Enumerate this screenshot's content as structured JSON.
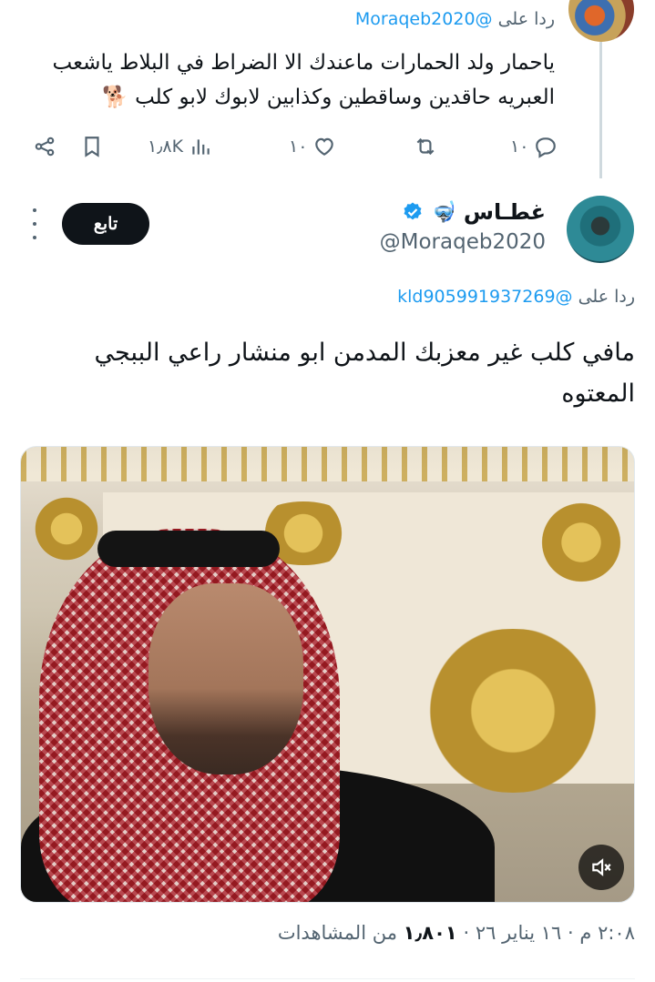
{
  "previous_tweet": {
    "reply_prefix": "ردا على",
    "reply_handle": "@Moraqeb2020",
    "text_line1": "ياحمار ولد الحمارات ماعندك الا الضراط في البلاط ياشعب",
    "text_line2": "العبريه حاقدين وساقطين وكذابين لابوك لابو كلب 🐕",
    "actions": {
      "replies": "١٠",
      "reposts": "",
      "likes": "١٠",
      "views": "١٫٨K"
    }
  },
  "main_tweet": {
    "display_name": "غطـاس",
    "name_emoji": "🤿",
    "handle": "@Moraqeb2020",
    "follow_label": "تابع",
    "reply_prefix": "ردا على",
    "reply_handle": "@kld905991937269",
    "text_line1": "مافي كلب غير معزبك المدمن ابو منشار راعي الببجي",
    "text_line2": "المعتوه",
    "time": "٢:٠٨ م",
    "date": "١٦ يناير ٢٦",
    "separator": "·",
    "views_count": "١٫٨٠١",
    "views_label": "من المشاهدات"
  },
  "icons": {
    "reply": "reply-icon",
    "repost": "repost-icon",
    "like": "heart-icon",
    "views": "views-chart-icon",
    "bookmark": "bookmark-icon",
    "share": "share-icon",
    "verified": "verified-badge-icon",
    "more": "more-options-icon",
    "mute": "muted-speaker-icon"
  },
  "colors": {
    "accent": "#1d9bf0",
    "secondary_text": "#536471",
    "follow_bg": "#0f1419"
  }
}
